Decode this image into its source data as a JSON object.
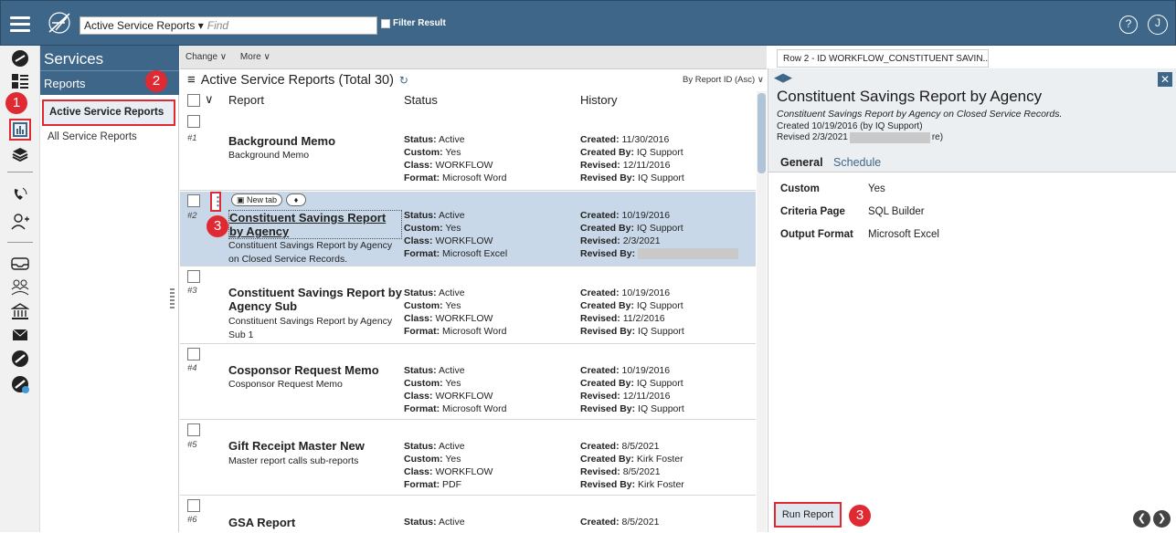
{
  "topbar": {
    "search_scope": "Active Service Reports ▾",
    "search_placeholder": "Find",
    "filter_label": "Filter Result",
    "help_icon": "help-icon",
    "user_initial": "J"
  },
  "sidebar": {
    "title": "Services",
    "section": "Reports",
    "items": [
      {
        "label": "Active Service Reports",
        "selected": true
      },
      {
        "label": "All Service Reports",
        "selected": false
      }
    ]
  },
  "list": {
    "toolbar": {
      "change": "Change ∨",
      "more": "More ∨"
    },
    "title": "Active Service Reports (Total 30)",
    "sort": "By Report ID (Asc) ∨",
    "columns": [
      "Report",
      "Status",
      "History"
    ],
    "rows": [
      {
        "num": "#1",
        "name": "Background Memo",
        "desc": "Background Memo",
        "status": "Active",
        "custom": "Yes",
        "class": "WORKFLOW",
        "format": "Microsoft Word",
        "created": "11/30/2016",
        "created_by": "IQ Support",
        "revised": "12/11/2016",
        "revised_by": "IQ Support"
      },
      {
        "num": "#2",
        "name": "Constituent Savings Report by Agency",
        "desc": "Constituent Savings Report by Agency on Closed Service Records.",
        "status": "Active",
        "custom": "Yes",
        "class": "WORKFLOW",
        "format": "Microsoft Excel",
        "created": "10/19/2016",
        "created_by": "IQ Support",
        "revised": "2/3/2021",
        "revised_by": "",
        "new_tab": "New tab"
      },
      {
        "num": "#3",
        "name": "Constituent Savings Report by Agency Sub",
        "desc": "Constituent Savings Report by Agency Sub 1",
        "status": "Active",
        "custom": "Yes",
        "class": "WORKFLOW",
        "format": "Microsoft Word",
        "created": "10/19/2016",
        "created_by": "IQ Support",
        "revised": "11/2/2016",
        "revised_by": "IQ Support"
      },
      {
        "num": "#4",
        "name": "Cosponsor Request Memo",
        "desc": "Cosponsor Request Memo",
        "status": "Active",
        "custom": "Yes",
        "class": "WORKFLOW",
        "format": "Microsoft Word",
        "created": "10/19/2016",
        "created_by": "IQ Support",
        "revised": "12/11/2016",
        "revised_by": "IQ Support"
      },
      {
        "num": "#5",
        "name": "Gift Receipt Master New",
        "desc": "Master report calls sub-reports",
        "status": "Active",
        "custom": "Yes",
        "class": "WORKFLOW",
        "format": "PDF",
        "created": "8/5/2021",
        "created_by": "Kirk Foster",
        "revised": "8/5/2021",
        "revised_by": "Kirk Foster"
      },
      {
        "num": "#6",
        "name": "GSA Report",
        "desc": "",
        "status": "Active",
        "created": "8/5/2021"
      }
    ]
  },
  "labels": {
    "status": "Status:",
    "custom": "Custom:",
    "class": "Class:",
    "format": "Format:",
    "created": "Created:",
    "created_by": "Created By:",
    "revised": "Revised:",
    "revised_by": "Revised By:"
  },
  "detail": {
    "row_indicator": "Row 2 - ID WORKFLOW_CONSTITUENT SAVIN...",
    "title": "Constituent Savings Report by Agency",
    "subtitle": "Constituent Savings Report by Agency on Closed Service Records.",
    "created": "Created 10/19/2016 (by IQ Support)",
    "revised": "Revised 2/3/2021",
    "revised_tail": "re)",
    "tabs": [
      "General",
      "Schedule"
    ],
    "fields": [
      {
        "key": "Custom",
        "value": "Yes"
      },
      {
        "key": "Criteria Page",
        "value": "SQL Builder"
      },
      {
        "key": "Output Format",
        "value": "Microsoft Excel"
      }
    ],
    "run_button": "Run Report"
  },
  "annotations": {
    "badge1": "1",
    "badge2": "2",
    "badge3": "3"
  },
  "colors": {
    "header": "#3d6688",
    "highlight": "#e02a33",
    "selected_row": "#c9d8e8"
  }
}
